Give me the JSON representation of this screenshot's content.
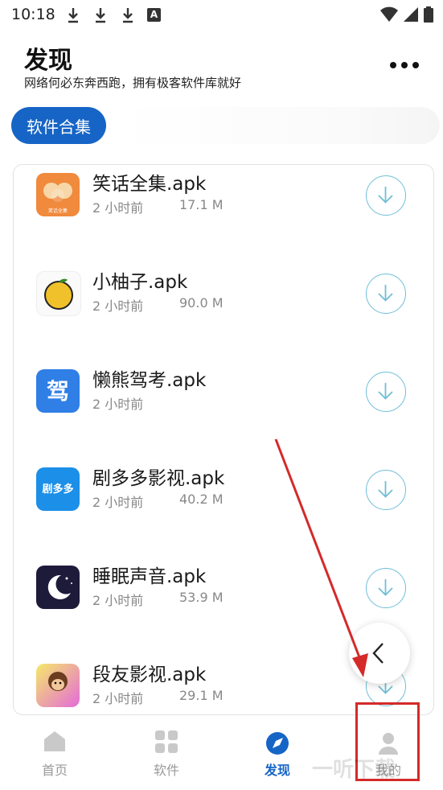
{
  "status_bar": {
    "time": "10:18",
    "indicator_letter": "A"
  },
  "header": {
    "title": "发现",
    "subtitle": "网络何必东奔西跑，拥有极客软件库就好"
  },
  "tabs": {
    "active_label": "软件合集"
  },
  "apps": [
    {
      "name": "笑话全集.apk",
      "time": "2 小时前",
      "size": "17.1 M",
      "icon_label": "笑话全集"
    },
    {
      "name": "小柚子.apk",
      "time": "2 小时前",
      "size": "90.0 M"
    },
    {
      "name": "懒熊驾考.apk",
      "time": "2 小时前",
      "size": "",
      "icon_label": "驾"
    },
    {
      "name": "剧多多影视.apk",
      "time": "2 小时前",
      "size": "40.2 M",
      "icon_label": "剧多多"
    },
    {
      "name": "睡眠声音.apk",
      "time": "2 小时前",
      "size": "53.9 M"
    },
    {
      "name": "段友影视.apk",
      "time": "2 小时前",
      "size": "29.1 M"
    }
  ],
  "bottom_nav": [
    {
      "label": "首页"
    },
    {
      "label": "软件"
    },
    {
      "label": "发现"
    },
    {
      "label": "我的"
    }
  ],
  "watermark": "一听下载",
  "colors": {
    "accent": "#1665c6",
    "download_ring": "#6fbfd8",
    "annotation": "#d42a2a"
  }
}
